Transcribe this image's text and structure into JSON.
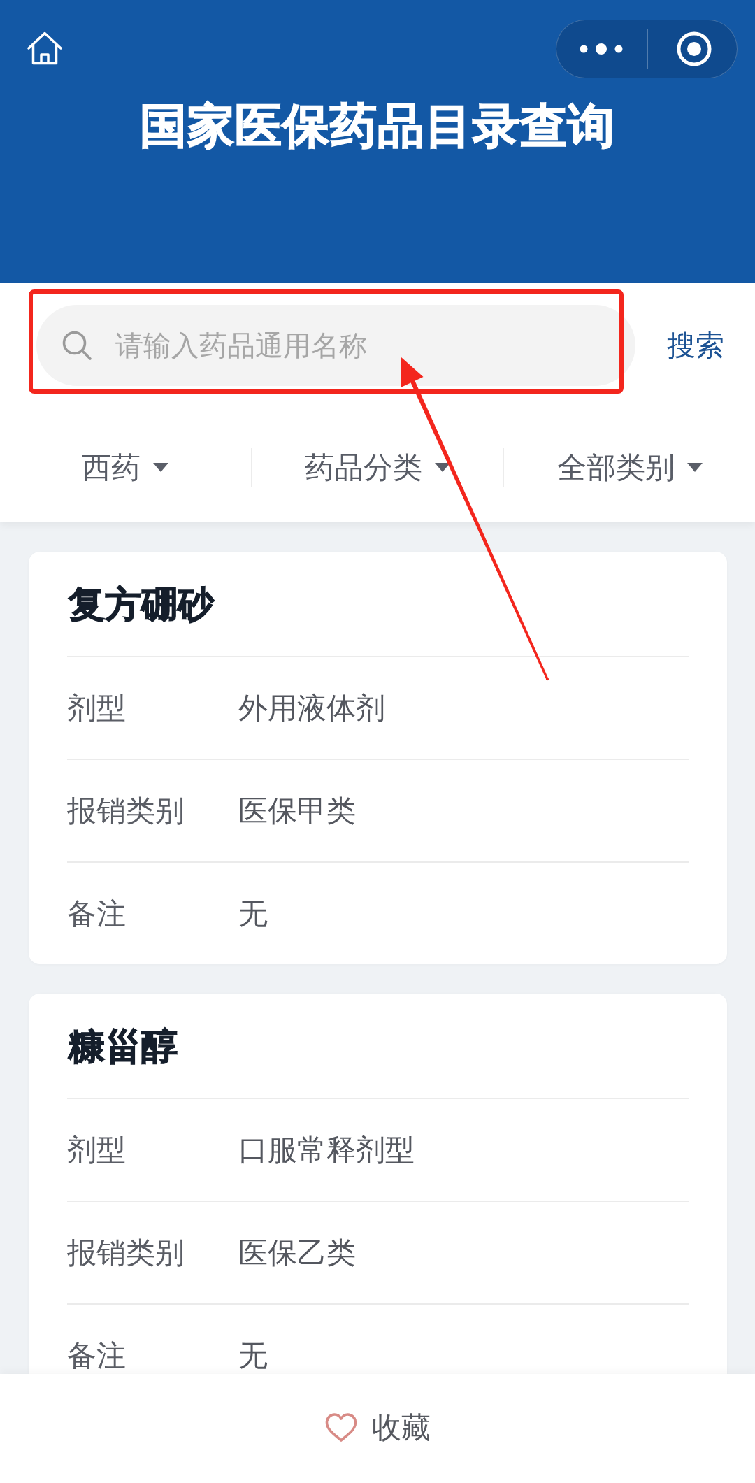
{
  "header": {
    "title": "国家医保药品目录查询"
  },
  "search": {
    "placeholder": "请输入药品通用名称",
    "button": "搜索"
  },
  "filters": [
    {
      "label": "西药"
    },
    {
      "label": "药品分类"
    },
    {
      "label": "全部类别"
    }
  ],
  "drugs": [
    {
      "name": "复方硼砂",
      "fields": [
        {
          "label": "剂型",
          "value": "外用液体剂"
        },
        {
          "label": "报销类别",
          "value": "医保甲类"
        },
        {
          "label": "备注",
          "value": "无"
        }
      ]
    },
    {
      "name": "糠甾醇",
      "fields": [
        {
          "label": "剂型",
          "value": "口服常释剂型"
        },
        {
          "label": "报销类别",
          "value": "医保乙类"
        },
        {
          "label": "备注",
          "value": "无"
        }
      ]
    }
  ],
  "bottom_bar": {
    "favorite": "收藏"
  }
}
